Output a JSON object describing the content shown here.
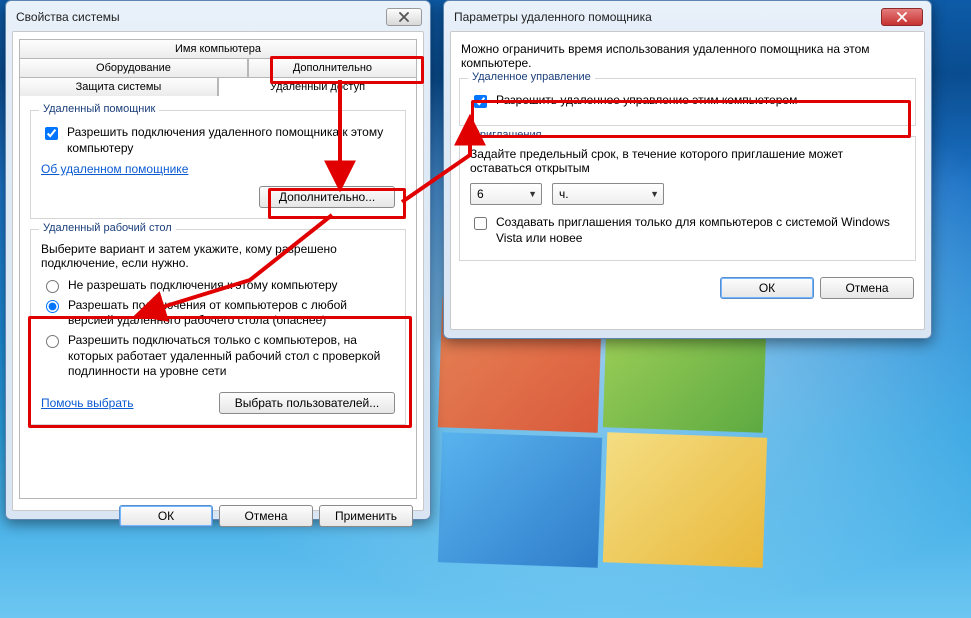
{
  "left": {
    "title": "Свойства системы",
    "tabs": {
      "name": "Имя компьютера",
      "hardware": "Оборудование",
      "advanced": "Дополнительно",
      "protection": "Защита системы",
      "remote": "Удаленный доступ"
    },
    "ra_group": {
      "legend": "Удаленный помощник",
      "allow_label": "Разрешить подключения удаленного помощника к этому компьютеру",
      "about_link": "Об удаленном помощнике",
      "advanced_btn": "Дополнительно..."
    },
    "rd_group": {
      "legend": "Удаленный рабочий стол",
      "hint": "Выберите вариант и затем укажите, кому разрешено подключение, если нужно.",
      "opt_deny": "Не разрешать подключения к этому компьютеру",
      "opt_any": "Разрешать подключения от компьютеров с любой версией удаленного рабочего стола (опаснее)",
      "opt_nla": "Разрешить подключаться только с компьютеров, на которых работает удаленный рабочий стол с проверкой подлинности на уровне сети",
      "help_link": "Помочь выбрать",
      "users_btn": "Выбрать пользователей..."
    },
    "buttons": {
      "ok": "ОК",
      "cancel": "Отмена",
      "apply": "Применить"
    }
  },
  "right": {
    "title": "Параметры удаленного помощника",
    "intro": "Можно ограничить время использования удаленного помощника на этом компьютере.",
    "ctrl_group": {
      "legend": "Удаленное управление",
      "allow_label": "Разрешить удаленное управление этим компьютером"
    },
    "inv_group": {
      "legend": "Приглашения",
      "hint": "Задайте предельный срок, в течение которого приглашение может оставаться открытым",
      "amount": "6",
      "unit": "ч.",
      "vista_label": "Создавать приглашения только для компьютеров с системой Windows Vista или новее"
    },
    "buttons": {
      "ok": "ОК",
      "cancel": "Отмена"
    }
  },
  "annotation_color": "#e10000"
}
